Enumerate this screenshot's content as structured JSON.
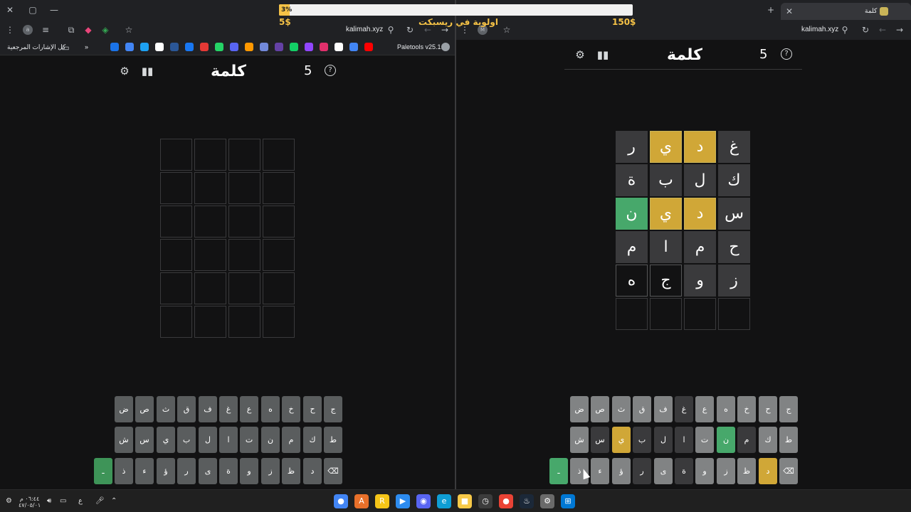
{
  "overlay": {
    "progress_text": "3%",
    "progress_fraction": 0.03,
    "left_amount": "5$",
    "center_label": "اولوية في ريسبكت",
    "right_amount": "150$"
  },
  "left_browser": {
    "url": "kalimah.xyz",
    "bookmarks_folder": "كل الإشارات المرجعية",
    "bookmark_more": "»",
    "paletools": "Paletools v25.1.9",
    "bookmark_icons": [
      "#1a73e8",
      "#4285f4",
      "#1da1f2",
      "#ffffff",
      "#2b5797",
      "#1877f2",
      "#e53935",
      "#25d366",
      "#5865f2",
      "#ff9800",
      "#7289da",
      "#6441a5",
      "#13ce66",
      "#9146ff",
      "#e1306c",
      "#ffffff",
      "#4285f4",
      "#ff0000"
    ]
  },
  "right_browser": {
    "tab_title": "كلمة",
    "url": "kalimah.xyz",
    "profile": "M"
  },
  "game": {
    "title": "كلمة",
    "number": "5",
    "help_icon": "help-icon",
    "stats_icon": "stats-icon",
    "settings_icon": "gear-icon"
  },
  "left_board": {
    "rows": [
      [
        "",
        "",
        "",
        ""
      ],
      [
        "",
        "",
        "",
        ""
      ],
      [
        "",
        "",
        "",
        ""
      ],
      [
        "",
        "",
        "",
        ""
      ],
      [
        "",
        "",
        "",
        ""
      ],
      [
        "",
        "",
        "",
        ""
      ]
    ]
  },
  "right_board": {
    "rows": [
      [
        {
          "l": "غ",
          "s": "absent"
        },
        {
          "l": "د",
          "s": "present"
        },
        {
          "l": "ي",
          "s": "present"
        },
        {
          "l": "ر",
          "s": "absent"
        }
      ],
      [
        {
          "l": "ك",
          "s": "absent"
        },
        {
          "l": "ل",
          "s": "absent"
        },
        {
          "l": "ب",
          "s": "absent"
        },
        {
          "l": "ة",
          "s": "absent"
        }
      ],
      [
        {
          "l": "س",
          "s": "absent"
        },
        {
          "l": "د",
          "s": "present"
        },
        {
          "l": "ي",
          "s": "present"
        },
        {
          "l": "ن",
          "s": "correct"
        }
      ],
      [
        {
          "l": "ح",
          "s": "absent"
        },
        {
          "l": "م",
          "s": "absent"
        },
        {
          "l": "ا",
          "s": "absent"
        },
        {
          "l": "م",
          "s": "absent"
        }
      ],
      [
        {
          "l": "ز",
          "s": "absent"
        },
        {
          "l": "و",
          "s": "absent"
        },
        {
          "l": "ج",
          "s": "typed"
        },
        {
          "l": "ه",
          "s": "typed"
        }
      ],
      [
        {
          "l": "",
          "s": "empty"
        },
        {
          "l": "",
          "s": "empty"
        },
        {
          "l": "",
          "s": "empty"
        },
        {
          "l": "",
          "s": "empty"
        }
      ]
    ]
  },
  "keyboard": {
    "row1": [
      "ج",
      "ح",
      "خ",
      "ه",
      "ع",
      "غ",
      "ف",
      "ق",
      "ث",
      "ص",
      "ض"
    ],
    "row2": [
      "ط",
      "ك",
      "م",
      "ن",
      "ت",
      "ا",
      "ل",
      "ب",
      "ي",
      "س",
      "ش"
    ],
    "row3": [
      "⌫",
      "د",
      "ظ",
      "ز",
      "و",
      "ة",
      "ى",
      "ر",
      "ؤ",
      "ء",
      "ذ",
      "ـ"
    ]
  },
  "right_key_states": {
    "row1": [
      "neutral",
      "neutral",
      "neutral",
      "neutral",
      "neutral",
      "absent",
      "neutral",
      "neutral",
      "neutral",
      "neutral",
      "neutral"
    ],
    "row2": [
      "neutral",
      "neutral",
      "absent",
      "correct",
      "neutral",
      "absent",
      "absent",
      "absent",
      "present",
      "absent",
      "neutral"
    ],
    "row3": [
      "neutral",
      "present",
      "neutral",
      "neutral",
      "neutral",
      "absent",
      "neutral",
      "absent",
      "neutral",
      "neutral",
      "neutral",
      "correct"
    ]
  },
  "left_key_states": {
    "row3_enter": "correct"
  },
  "taskbar": {
    "time": "٠٦:٤٤ م",
    "date": "٤٧/٠٥/٠١",
    "lang": "ع",
    "apps": [
      {
        "name": "chrome-icon",
        "color": "#4285f4",
        "glyph": "●"
      },
      {
        "name": "app-a-icon",
        "color": "#e8702a",
        "glyph": "A"
      },
      {
        "name": "app-r-icon",
        "color": "#f5c518",
        "glyph": "R"
      },
      {
        "name": "app-play-icon",
        "color": "#2d8cf0",
        "glyph": "▶"
      },
      {
        "name": "discord-icon",
        "color": "#5865f2",
        "glyph": "◉"
      },
      {
        "name": "edge-icon",
        "color": "#0f9ed5",
        "glyph": "e"
      },
      {
        "name": "folder-icon",
        "color": "#f7c948",
        "glyph": "■"
      },
      {
        "name": "clock-icon",
        "color": "#3c3c3c",
        "glyph": "◷"
      },
      {
        "name": "chrome2-icon",
        "color": "#ea4335",
        "glyph": "●"
      },
      {
        "name": "steam-icon",
        "color": "#1b2838",
        "glyph": "♨"
      },
      {
        "name": "settings-icon",
        "color": "#6a6a6a",
        "glyph": "⚙"
      },
      {
        "name": "windows-icon",
        "color": "#0078d4",
        "glyph": "⊞"
      }
    ]
  }
}
